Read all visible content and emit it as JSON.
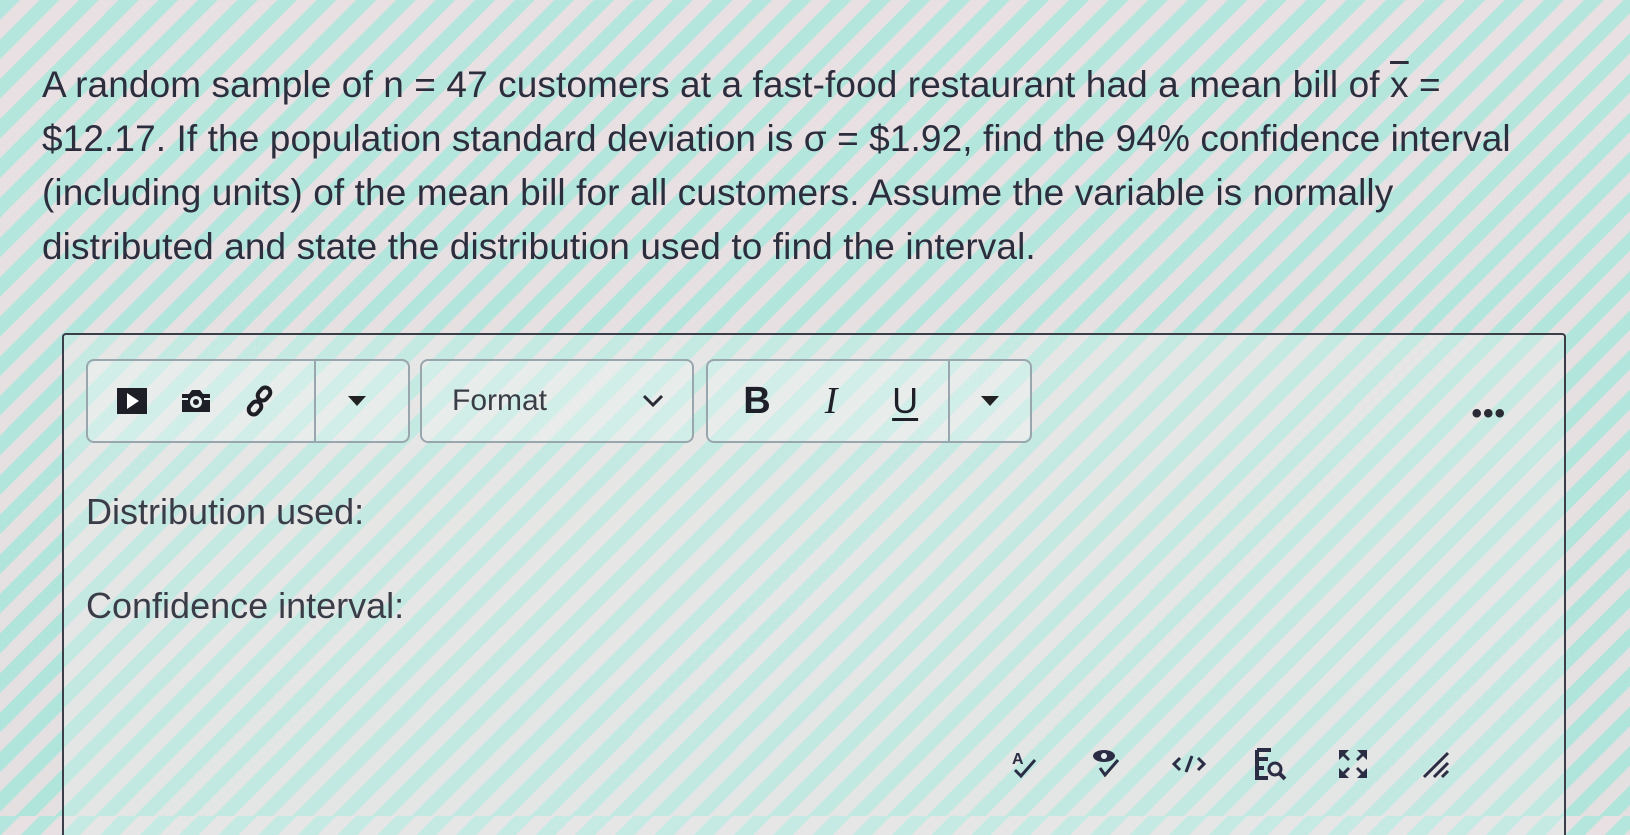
{
  "question": {
    "part1": "A random sample of n = 47 customers at a fast-food restaurant had a mean bill of ",
    "xbar_symbol": "x",
    "part2": " = $12.17. If the population standard deviation is σ = $1.92, find the 94% confidence interval (including units) of the mean bill for all customers. Assume the variable is normally distributed and state the distribution used to find the interval."
  },
  "toolbar": {
    "insert_group": [
      {
        "icon": "media-play-icon",
        "label": "Insert media"
      },
      {
        "icon": "camera-icon",
        "label": "Insert image"
      },
      {
        "icon": "link-icon",
        "label": "Insert link"
      }
    ],
    "insert_more_icon": "caret-down-icon",
    "format_select": {
      "selected": "Format",
      "icon": "chevron-down-icon"
    },
    "style_group": [
      {
        "label": "B",
        "name": "bold"
      },
      {
        "label": "I",
        "name": "italic"
      },
      {
        "label": "U",
        "name": "underline"
      }
    ],
    "style_more_icon": "caret-down-icon",
    "more_label": "•••"
  },
  "editor": {
    "lines": [
      "Distribution used:",
      "Confidence interval:"
    ]
  },
  "status_bar": [
    {
      "icon": "spellcheck-icon",
      "label": "Spell check"
    },
    {
      "icon": "accessibility-check-icon",
      "label": "Accessibility checker"
    },
    {
      "icon": "source-code-icon",
      "label": "Source code"
    },
    {
      "icon": "equation-editor-icon",
      "label": "Equation editor"
    },
    {
      "icon": "fullscreen-icon",
      "label": "Fullscreen"
    },
    {
      "icon": "resize-handle-icon",
      "label": "Resize"
    }
  ]
}
